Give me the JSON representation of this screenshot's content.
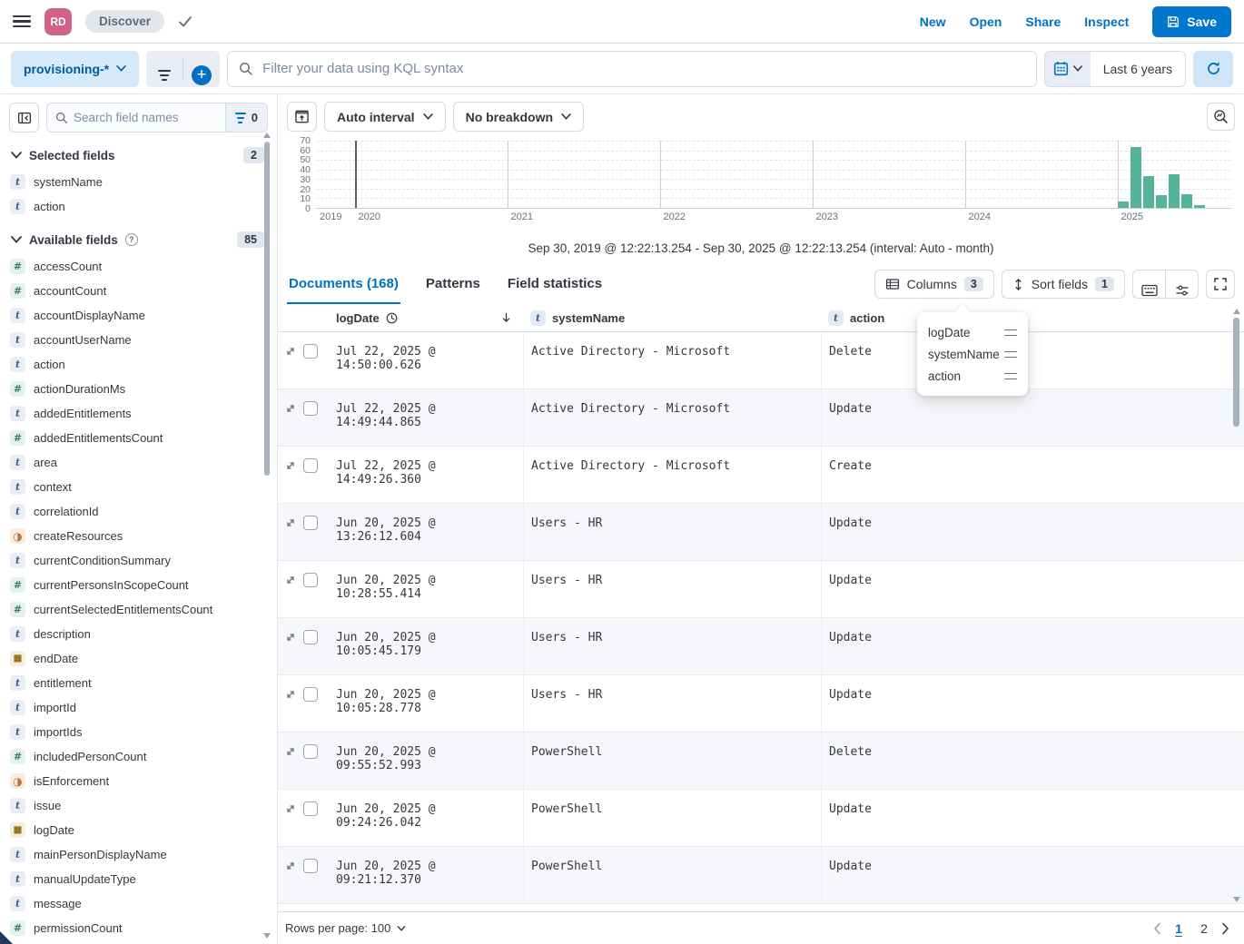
{
  "header": {
    "avatar_initials": "RD",
    "breadcrumb": "Discover",
    "nav_links": [
      "New",
      "Open",
      "Share",
      "Inspect"
    ],
    "save_label": "Save"
  },
  "query_bar": {
    "data_view": "provisioning-*",
    "kql_placeholder": "Filter your data using KQL syntax",
    "time_range": "Last 6 years"
  },
  "sidebar": {
    "search_placeholder": "Search field names",
    "field_filters_count": "0",
    "selected_section": {
      "label": "Selected fields",
      "count": "2"
    },
    "selected_fields": [
      {
        "name": "systemName",
        "type": "t"
      },
      {
        "name": "action",
        "type": "t"
      }
    ],
    "available_section": {
      "label": "Available fields",
      "count": "85"
    },
    "available_fields": [
      {
        "name": "accessCount",
        "type": "num"
      },
      {
        "name": "accountCount",
        "type": "num"
      },
      {
        "name": "accountDisplayName",
        "type": "t"
      },
      {
        "name": "accountUserName",
        "type": "t"
      },
      {
        "name": "action",
        "type": "t"
      },
      {
        "name": "actionDurationMs",
        "type": "num"
      },
      {
        "name": "addedEntitlements",
        "type": "t"
      },
      {
        "name": "addedEntitlementsCount",
        "type": "num"
      },
      {
        "name": "area",
        "type": "t"
      },
      {
        "name": "context",
        "type": "t"
      },
      {
        "name": "correlationId",
        "type": "t"
      },
      {
        "name": "createResources",
        "type": "bool"
      },
      {
        "name": "currentConditionSummary",
        "type": "t"
      },
      {
        "name": "currentPersonsInScopeCount",
        "type": "num"
      },
      {
        "name": "currentSelectedEntitlementsCount",
        "type": "num"
      },
      {
        "name": "description",
        "type": "t"
      },
      {
        "name": "endDate",
        "type": "date"
      },
      {
        "name": "entitlement",
        "type": "t"
      },
      {
        "name": "importId",
        "type": "t"
      },
      {
        "name": "importIds",
        "type": "t"
      },
      {
        "name": "includedPersonCount",
        "type": "num"
      },
      {
        "name": "isEnforcement",
        "type": "bool"
      },
      {
        "name": "issue",
        "type": "t"
      },
      {
        "name": "logDate",
        "type": "date"
      },
      {
        "name": "mainPersonDisplayName",
        "type": "t"
      },
      {
        "name": "manualUpdateType",
        "type": "t"
      },
      {
        "name": "message",
        "type": "t"
      },
      {
        "name": "permissionCount",
        "type": "num"
      }
    ]
  },
  "chart_controls": {
    "interval_label": "Auto interval",
    "breakdown_label": "No breakdown",
    "caption": "Sep 30, 2019 @ 12:22:13.254 - Sep 30, 2025 @ 12:22:13.254 (interval: Auto - month)"
  },
  "chart_data": {
    "type": "bar",
    "title": "",
    "x": [
      "2025-01",
      "2025-02",
      "2025-03",
      "2025-04",
      "2025-05",
      "2025-06",
      "2025-07"
    ],
    "values": [
      7,
      63,
      33,
      13,
      35,
      14,
      3
    ],
    "x_domain_years": [
      2019.747,
      2025.747
    ],
    "x_axis_years": [
      2019,
      2020,
      2021,
      2022,
      2023,
      2024,
      2025
    ],
    "yticks_top_to_bottom": [
      70,
      60,
      50,
      40,
      30,
      20,
      10,
      0
    ],
    "ylim": [
      0,
      70
    ],
    "bar_color": "#54b399",
    "grid": "dashed-horizontal",
    "legend": "none"
  },
  "tabs": {
    "documents": "Documents (168)",
    "patterns": "Patterns",
    "field_statistics": "Field statistics"
  },
  "grid_toolbar": {
    "columns_label": "Columns",
    "columns_count": "3",
    "sort_label": "Sort fields",
    "sort_count": "1"
  },
  "columns_popover": {
    "items": [
      "logDate",
      "systemName",
      "action"
    ]
  },
  "table": {
    "columns": {
      "logdate_label": "logDate",
      "system_label": "systemName",
      "action_label": "action"
    },
    "rows": [
      {
        "logDate": "Jul 22, 2025 @ 14:50:00.626",
        "systemName": "Active Directory - Microsoft",
        "action": "Delete"
      },
      {
        "logDate": "Jul 22, 2025 @ 14:49:44.865",
        "systemName": "Active Directory - Microsoft",
        "action": "Update"
      },
      {
        "logDate": "Jul 22, 2025 @ 14:49:26.360",
        "systemName": "Active Directory - Microsoft",
        "action": "Create"
      },
      {
        "logDate": "Jun 20, 2025 @ 13:26:12.604",
        "systemName": "Users - HR",
        "action": "Update"
      },
      {
        "logDate": "Jun 20, 2025 @ 10:28:55.414",
        "systemName": "Users - HR",
        "action": "Update"
      },
      {
        "logDate": "Jun 20, 2025 @ 10:05:45.179",
        "systemName": "Users - HR",
        "action": "Update"
      },
      {
        "logDate": "Jun 20, 2025 @ 10:05:28.778",
        "systemName": "Users - HR",
        "action": "Update"
      },
      {
        "logDate": "Jun 20, 2025 @ 09:55:52.993",
        "systemName": "PowerShell",
        "action": "Delete"
      },
      {
        "logDate": "Jun 20, 2025 @ 09:24:26.042",
        "systemName": "PowerShell",
        "action": "Update"
      },
      {
        "logDate": "Jun 20, 2025 @ 09:21:12.370",
        "systemName": "PowerShell",
        "action": "Update"
      }
    ]
  },
  "footer": {
    "rows_per_page": "Rows per page: 100",
    "pages": [
      "1",
      "2"
    ]
  },
  "colors": {
    "accent_blue": "#0071c2",
    "bar_green": "#54b399",
    "avatar_pink": "#d36086",
    "row_stripe": "#f5f7fa"
  }
}
